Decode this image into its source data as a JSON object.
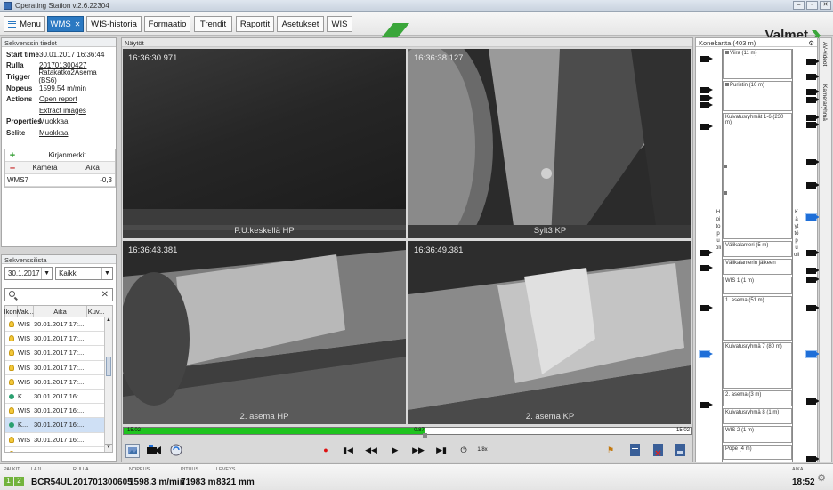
{
  "window": {
    "title": "Operating Station v.2.6.22304"
  },
  "toolbar": {
    "menu_label": "Menu",
    "tabs": [
      {
        "label": "WMS",
        "active": true,
        "closable": true
      },
      {
        "label": "WIS-historia"
      },
      {
        "label": "Formaatio"
      },
      {
        "label": "Trendit"
      },
      {
        "label": "Raportit"
      },
      {
        "label": "Asetukset"
      },
      {
        "label": "WIS"
      }
    ],
    "logo": "Valmet",
    "accent": "#2b79c2",
    "logo_color": "#3aa63a"
  },
  "sequence_info": {
    "header": "Sekvenssin tiedot",
    "start_time_label": "Start time",
    "start_time": "30.01.2017 16:36:44",
    "roll_label": "Rulla",
    "roll": "201701300427",
    "trigger_label": "Trigger",
    "trigger": "Ratakatko2Asema (BS6)",
    "speed_label": "Nopeus",
    "speed": "1599.54 m/min",
    "actions_label": "Actions",
    "action_open": "Open report",
    "action_extract": "Extract images",
    "properties_label": "Properties",
    "properties": "Muokkaa",
    "note_label": "Selite",
    "note": "Muokkaa"
  },
  "bookmarks": {
    "title": "Kirjanmerkit",
    "add": "+",
    "remove": "–",
    "col_camera": "Kamera",
    "col_time": "Aika",
    "rows": [
      {
        "camera": "WMS7",
        "time": "-0,3"
      }
    ]
  },
  "sequence_list": {
    "header": "Sekvenssilista",
    "date": "30.1.2017",
    "filter": "Kaikki",
    "search_placeholder": "",
    "columns": [
      "Ikoni",
      "Vak...",
      "Aika",
      "Kuv..."
    ],
    "rows": [
      {
        "icon": "bulb",
        "vak": "WIS",
        "aika": "30.01.2017 17:..."
      },
      {
        "icon": "bulb",
        "vak": "WIS",
        "aika": "30.01.2017 17:..."
      },
      {
        "icon": "bulb",
        "vak": "WIS",
        "aika": "30.01.2017 17:..."
      },
      {
        "icon": "bulb",
        "vak": "WIS",
        "aika": "30.01.2017 17:..."
      },
      {
        "icon": "bulb",
        "vak": "WIS",
        "aika": "30.01.2017 17:..."
      },
      {
        "icon": "dot",
        "vak": "K...",
        "aika": "30.01.2017 16:..."
      },
      {
        "icon": "bulb",
        "vak": "WIS",
        "aika": "30.01.2017 16:..."
      },
      {
        "icon": "dot",
        "vak": "K...",
        "aika": "30.01.2017 16:...",
        "selected": true
      },
      {
        "icon": "bulb",
        "vak": "WIS",
        "aika": "30.01.2017 16:..."
      },
      {
        "icon": "bulb",
        "vak": "WIS",
        "aika": "30.01.2017 16:..."
      }
    ]
  },
  "viewer": {
    "header": "Näytöt",
    "cameras": [
      {
        "timestamp": "16:36:30.971",
        "label": "P.U.keskellä HP"
      },
      {
        "timestamp": "16:36:38.127",
        "label": "Sylt3 KP"
      },
      {
        "timestamp": "16:36:43.381",
        "label": "2. asema HP"
      },
      {
        "timestamp": "16:36:49.381",
        "label": "2. asema KP"
      }
    ],
    "timeline": {
      "start": "-15.02",
      "current": "0.87",
      "end": "15.02",
      "progress": 0.53,
      "color": "#1fc31f"
    },
    "speed_label": "1/8x"
  },
  "machine": {
    "header": "Konekartta (403 m)",
    "sections": [
      "Viira (11 m)",
      "Puristin (10 m)",
      "Kuivatusryhmät 1-6 (230 m)",
      "Välikalanteri (5 m)",
      "Välikalanterin jälkeen",
      "WIS 1 (1 m)",
      "1. asema (51 m)",
      "Kuivatusryhmä 7 (80 m)",
      "2. asema (3 m)",
      "Kuivatusryhmä 8 (1 m)",
      "WIS 2 (1 m)",
      "Pope (4 m)"
    ],
    "left_label": "Hoitopuoli",
    "right_label": "Käyttöpuoli"
  },
  "side_tabs": [
    "AV-videot",
    "Kameraryhmä"
  ],
  "status": {
    "palkit_label": "PALKIT",
    "palkit": [
      "1",
      "2"
    ],
    "laji_label": "LAJI",
    "laji": "BCR54UL",
    "rulla_label": "RULLA",
    "rulla": "201701300605",
    "nopeus_label": "NOPEUS",
    "nopeus": "1598.3 m/min",
    "pituus_label": "PITUUS",
    "pituus": "71983 m",
    "leveys_label": "LEVEYS",
    "leveys": "8321 mm",
    "aika_label": "AIKA",
    "aika": "18:52"
  }
}
